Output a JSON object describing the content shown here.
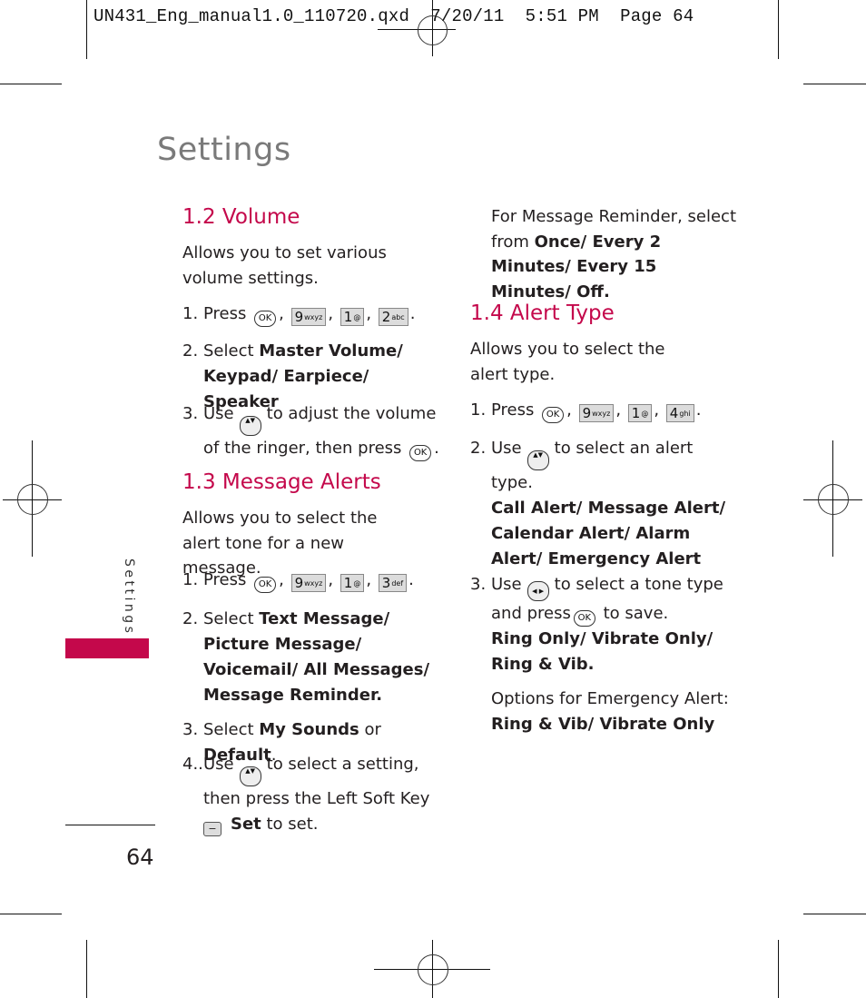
{
  "slug": "UN431_Eng_manual1.0_110720.qxd  7/20/11  5:51 PM  Page 64",
  "page_title": "Settings",
  "side_tab_label": "Settings",
  "page_number": "64",
  "colors": {
    "accent": "#c4084b",
    "title_gray": "#7a7a7a",
    "text": "#231f20"
  },
  "keys": {
    "ok": "OK",
    "k9": {
      "digit": "9",
      "letters": "wxyz"
    },
    "k1": {
      "digit": "1",
      "letters": "@"
    },
    "k2": {
      "digit": "2",
      "letters": "abc"
    },
    "k3": {
      "digit": "3",
      "letters": "def"
    },
    "k4": {
      "digit": "4",
      "letters": "ghi"
    },
    "nav_ud": "▲▼",
    "nav_lr": "◀ ▶",
    "soft": "−"
  },
  "volume": {
    "heading": "1.2 Volume",
    "intro": "Allows you to set various volume settings.",
    "step1": {
      "num": "1.",
      "text": "Press"
    },
    "step2": {
      "num": "2.",
      "prefix": "Select ",
      "bold": "Master Volume/ Keypad/ Earpiece/ Speaker"
    },
    "step3": {
      "num": "3.",
      "prefix": "Use",
      "suffix": "to adjust the volume of the ringer, then press"
    }
  },
  "message_alerts": {
    "heading": "1.3 Message Alerts",
    "intro": "Allows you to select the alert tone for a new message.",
    "step1": {
      "num": "1.",
      "text": "Press"
    },
    "step2": {
      "num": "2.",
      "prefix": "Select ",
      "bold": "Text Message/ Picture Message/ Voicemail/ All Messages/ Message Reminder."
    },
    "step3": {
      "num": "3.",
      "prefix": "Select ",
      "bold1": "My Sounds",
      "mid": " or ",
      "bold2": "Default",
      "end": "."
    },
    "step4": {
      "num": "4..",
      "prefix": "Use",
      "suffix": "to select a setting, then press the Left Soft Key",
      "bold": "Set",
      "end": " to set."
    }
  },
  "reminder_note": {
    "prefix": "For Message Reminder, select from ",
    "bold": "Once/ Every 2 Minutes/ Every 15 Minutes/ Off."
  },
  "alert_type": {
    "heading": "1.4 Alert Type",
    "intro": "Allows you to select the alert type.",
    "step1": {
      "num": "1.",
      "text": "Press"
    },
    "step2": {
      "num": "2.",
      "prefix": "Use",
      "suffix": "to select an alert type.",
      "bold": "Call Alert/ Message Alert/ Calendar Alert/ Alarm Alert/ Emergency Alert"
    },
    "step3": {
      "num": "3.",
      "prefix": "Use",
      "mid": "to select a tone type and press",
      "suffix": "to save.",
      "bold": "Ring Only/ Vibrate Only/ Ring & Vib."
    },
    "emergency_label": "Options for Emergency Alert:",
    "emergency_bold": "Ring & Vib/ Vibrate Only"
  }
}
